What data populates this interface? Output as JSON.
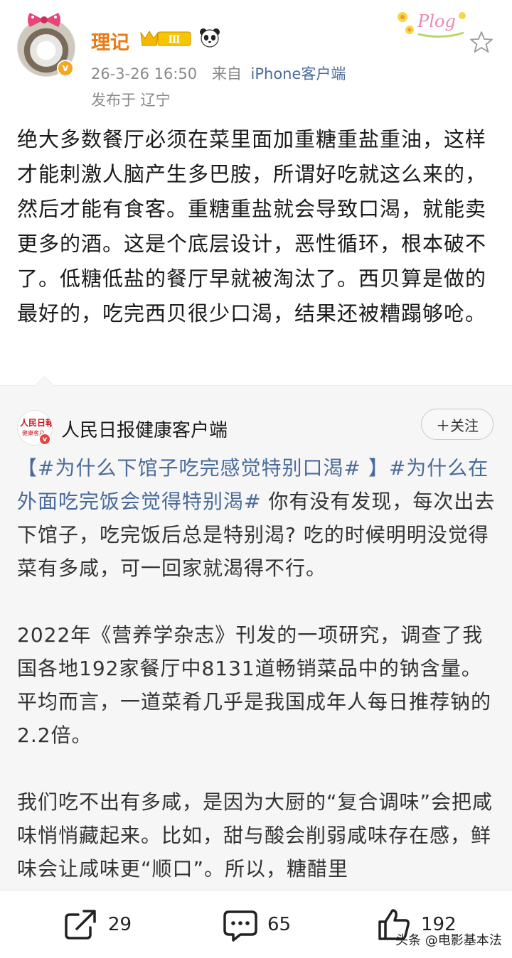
{
  "post": {
    "author": {
      "name": "理记",
      "level_badge": "Ⅲ",
      "verified": true
    },
    "meta": {
      "time": "26-3-26 16:50",
      "source_prefix": "来自",
      "source": "iPhone客户端",
      "location": "发布于 辽宁"
    },
    "decor_text": "Plog",
    "body": "绝大多数餐厅必须在菜里面加重糖重盐重油，这样才能刺激人脑产生多巴胺，所谓好吃就这么来的，然后才能有食客。重糖重盐就会导致口渴，就能卖更多的酒。这是个底层设计，恶性循环，根本破不了。低糖低盐的餐厅早就被淘汰了。西贝算是做的最好的，吃完西贝很少口渴，结果还被糟蹋够呛。"
  },
  "retweet": {
    "author": {
      "name": "人民日报健康客户端",
      "logo_text": "人民日報",
      "logo_sub": "健康客户"
    },
    "follow_label": "＋关注",
    "tag1": "【#为什么下馆子吃完感觉特别口渴# 】",
    "tag2": "#为什么在外面吃完饭会觉得特别渴#",
    "para1_rest": " 你有没有发现，每次出去下馆子，吃完饭后总是特别渴? 吃的时候明明没觉得菜有多咸，可一回家就渴得不行。",
    "para2": "2022年《营养学杂志》刊发的一项研究，调查了我国各地192家餐厅中8131道畅销菜品中的钠含量。平均而言，一道菜肴几乎是我国成年人每日推荐钠的2.2倍。",
    "para3": "我们吃不出有多咸，是因为大厨的“复合调味”会把咸味悄悄藏起来。比如，甜与酸会削弱咸味存在感，鲜味会让咸味更“顺口”。所以，糖醋里"
  },
  "toolbar": {
    "repost_count": "29",
    "comment_count": "65",
    "like_count": "192"
  },
  "watermark": "头条 @电影基本法"
}
